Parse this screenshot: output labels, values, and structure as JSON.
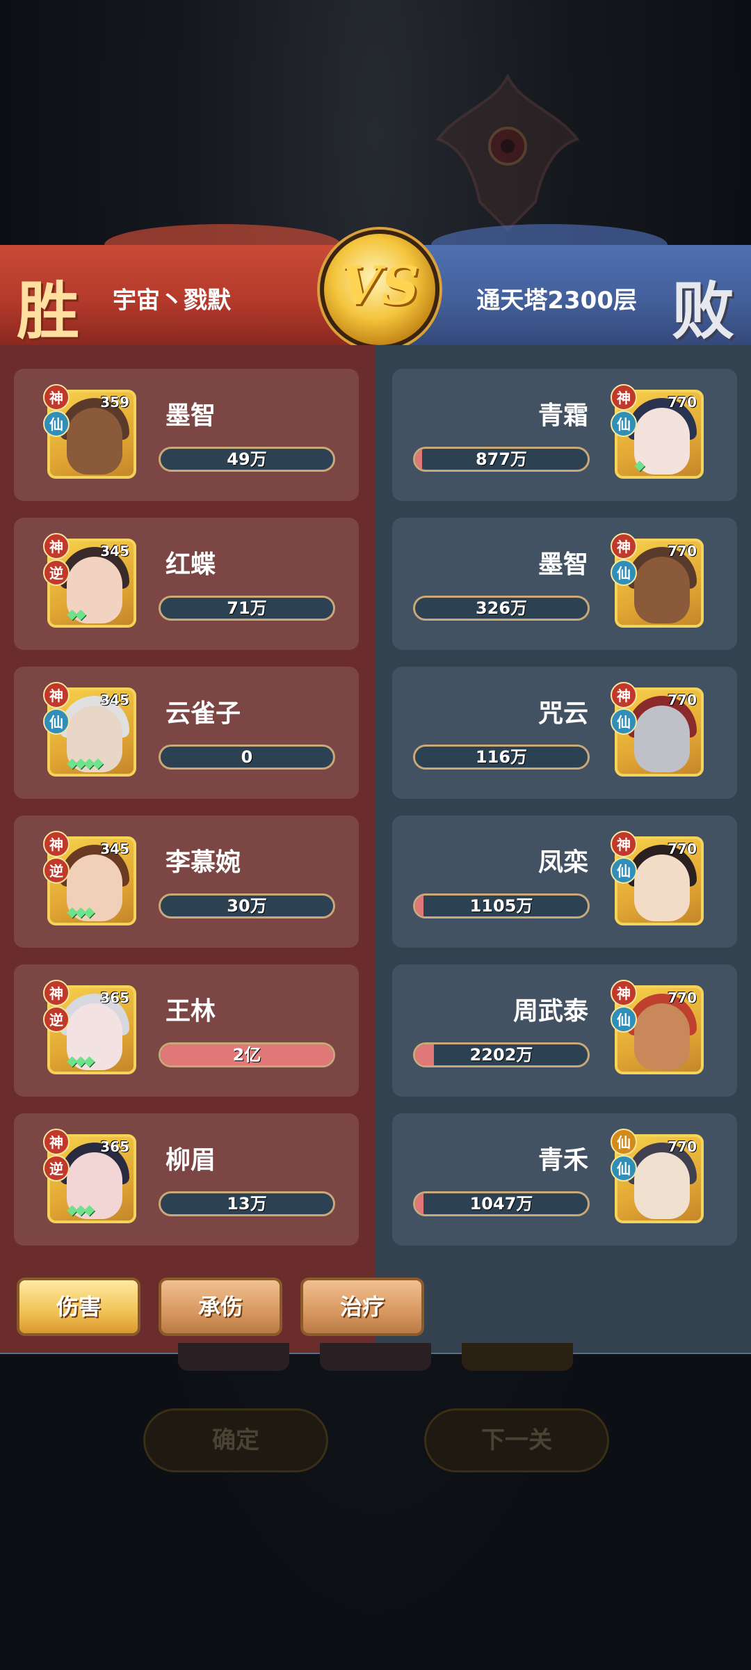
{
  "header": {
    "win_label": "胜",
    "lose_label": "败",
    "vs_label": "VS",
    "left_player": "宇宙丶戮默",
    "right_player": "通天塔2300层"
  },
  "colors": {
    "left_accent": "#c84a36",
    "right_accent": "#4f6fb0",
    "bar_fill": "#e07878",
    "tab_active": "#f2c256"
  },
  "left_team": [
    {
      "name": "墨智",
      "level": "359",
      "tag_top": "神",
      "tag_mid": "仙",
      "value": "49万",
      "fill": 0.0,
      "gems": ""
    },
    {
      "name": "红蝶",
      "level": "345",
      "tag_top": "神",
      "tag_mid": "逆",
      "value": "71万",
      "fill": 0.0,
      "gems": "◆◆"
    },
    {
      "name": "云雀子",
      "level": "345",
      "tag_top": "神",
      "tag_mid": "仙",
      "value": "0",
      "fill": 0.0,
      "gems": "◆◆◆◆"
    },
    {
      "name": "李慕婉",
      "level": "345",
      "tag_top": "神",
      "tag_mid": "逆",
      "value": "30万",
      "fill": 0.0,
      "gems": "◆◆◆"
    },
    {
      "name": "王林",
      "level": "365",
      "tag_top": "神",
      "tag_mid": "逆",
      "value": "2亿",
      "fill": 1.0,
      "gems": "◆◆◆"
    },
    {
      "name": "柳眉",
      "level": "365",
      "tag_top": "神",
      "tag_mid": "逆",
      "value": "13万",
      "fill": 0.0,
      "gems": "◆◆◆"
    }
  ],
  "right_team": [
    {
      "name": "青霜",
      "level": "770",
      "tag_top": "神",
      "tag_mid": "仙",
      "value": "877万",
      "fill": 0.04,
      "gems": "◆"
    },
    {
      "name": "墨智",
      "level": "770",
      "tag_top": "神",
      "tag_mid": "仙",
      "value": "326万",
      "fill": 0.0,
      "gems": ""
    },
    {
      "name": "咒云",
      "level": "770",
      "tag_top": "神",
      "tag_mid": "仙",
      "value": "116万",
      "fill": 0.0,
      "gems": ""
    },
    {
      "name": "凤栾",
      "level": "770",
      "tag_top": "神",
      "tag_mid": "仙",
      "value": "1105万",
      "fill": 0.05,
      "gems": ""
    },
    {
      "name": "周武泰",
      "level": "770",
      "tag_top": "神",
      "tag_mid": "仙",
      "value": "2202万",
      "fill": 0.11,
      "gems": ""
    },
    {
      "name": "青禾",
      "level": "770",
      "tag_top": "仙",
      "tag_mid": "仙",
      "value": "1047万",
      "fill": 0.05,
      "gems": ""
    }
  ],
  "tabs": [
    {
      "label": "伤害",
      "active": true
    },
    {
      "label": "承伤",
      "active": false
    },
    {
      "label": "治疗",
      "active": false
    }
  ],
  "footer": {
    "confirm_label": "确定",
    "next_label": "下一关"
  }
}
